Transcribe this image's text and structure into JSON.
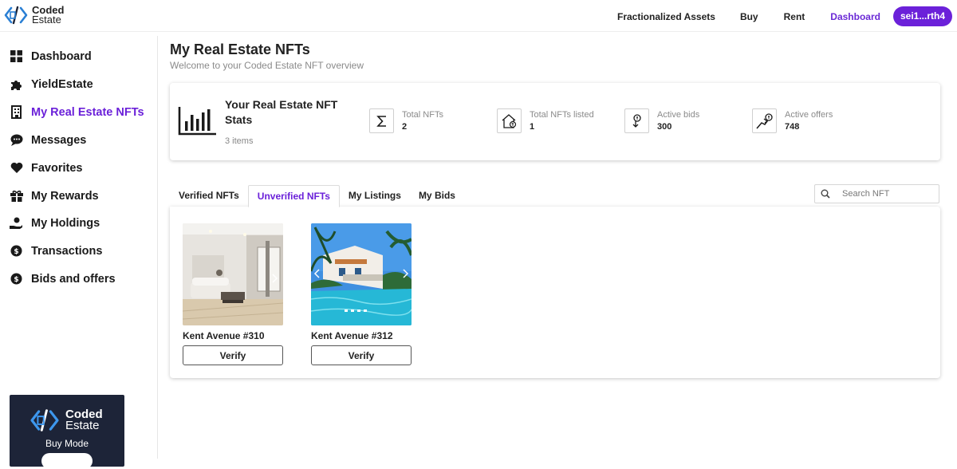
{
  "brand": {
    "line1": "Coded",
    "line2": "Estate",
    "accent": "#6b21d9"
  },
  "nav": {
    "links": [
      "Fractionalized Assets",
      "Buy",
      "Rent",
      "Dashboard"
    ],
    "active": "Dashboard",
    "wallet": "sei1...rth4"
  },
  "sidebar": {
    "items": [
      {
        "label": "Dashboard",
        "icon": "dashboard-grid-icon"
      },
      {
        "label": "YieldEstate",
        "icon": "puzzle-icon"
      },
      {
        "label": "My Real Estate NFTs",
        "icon": "building-icon"
      },
      {
        "label": "Messages",
        "icon": "chat-bubble-icon"
      },
      {
        "label": "Favorites",
        "icon": "heart-icon"
      },
      {
        "label": "My Rewards",
        "icon": "gift-icon"
      },
      {
        "label": "My Holdings",
        "icon": "hand-coin-icon"
      },
      {
        "label": "Transactions",
        "icon": "dollar-coin-icon"
      },
      {
        "label": "Bids and offers",
        "icon": "dollar-coin-icon"
      }
    ],
    "active_index": 2,
    "promo": {
      "line1": "Coded",
      "line2": "Estate",
      "mode": "Buy Mode"
    }
  },
  "main": {
    "title": "My Real Estate NFTs",
    "subtitle": "Welcome to your Coded Estate NFT overview",
    "stats": {
      "title": "Your Real Estate NFT Stats",
      "count": "3 items",
      "items": [
        {
          "label": "Total NFTs",
          "value": "2",
          "icon": "sigma-icon"
        },
        {
          "label": "Total NFTs listed",
          "value": "1",
          "icon": "house-listing-icon"
        },
        {
          "label": "Active bids",
          "value": "300",
          "icon": "bid-icon"
        },
        {
          "label": "Active offers",
          "value": "748",
          "icon": "offer-icon"
        }
      ]
    },
    "tabs": [
      "Verified NFTs",
      "Unverified NFTs",
      "My Listings",
      "My Bids"
    ],
    "active_tab": 1,
    "search_placeholder": "Search NFT",
    "cards": [
      {
        "name": "Kent Avenue #310",
        "button": "Verify"
      },
      {
        "name": "Kent Avenue #312",
        "button": "Verify"
      }
    ]
  }
}
